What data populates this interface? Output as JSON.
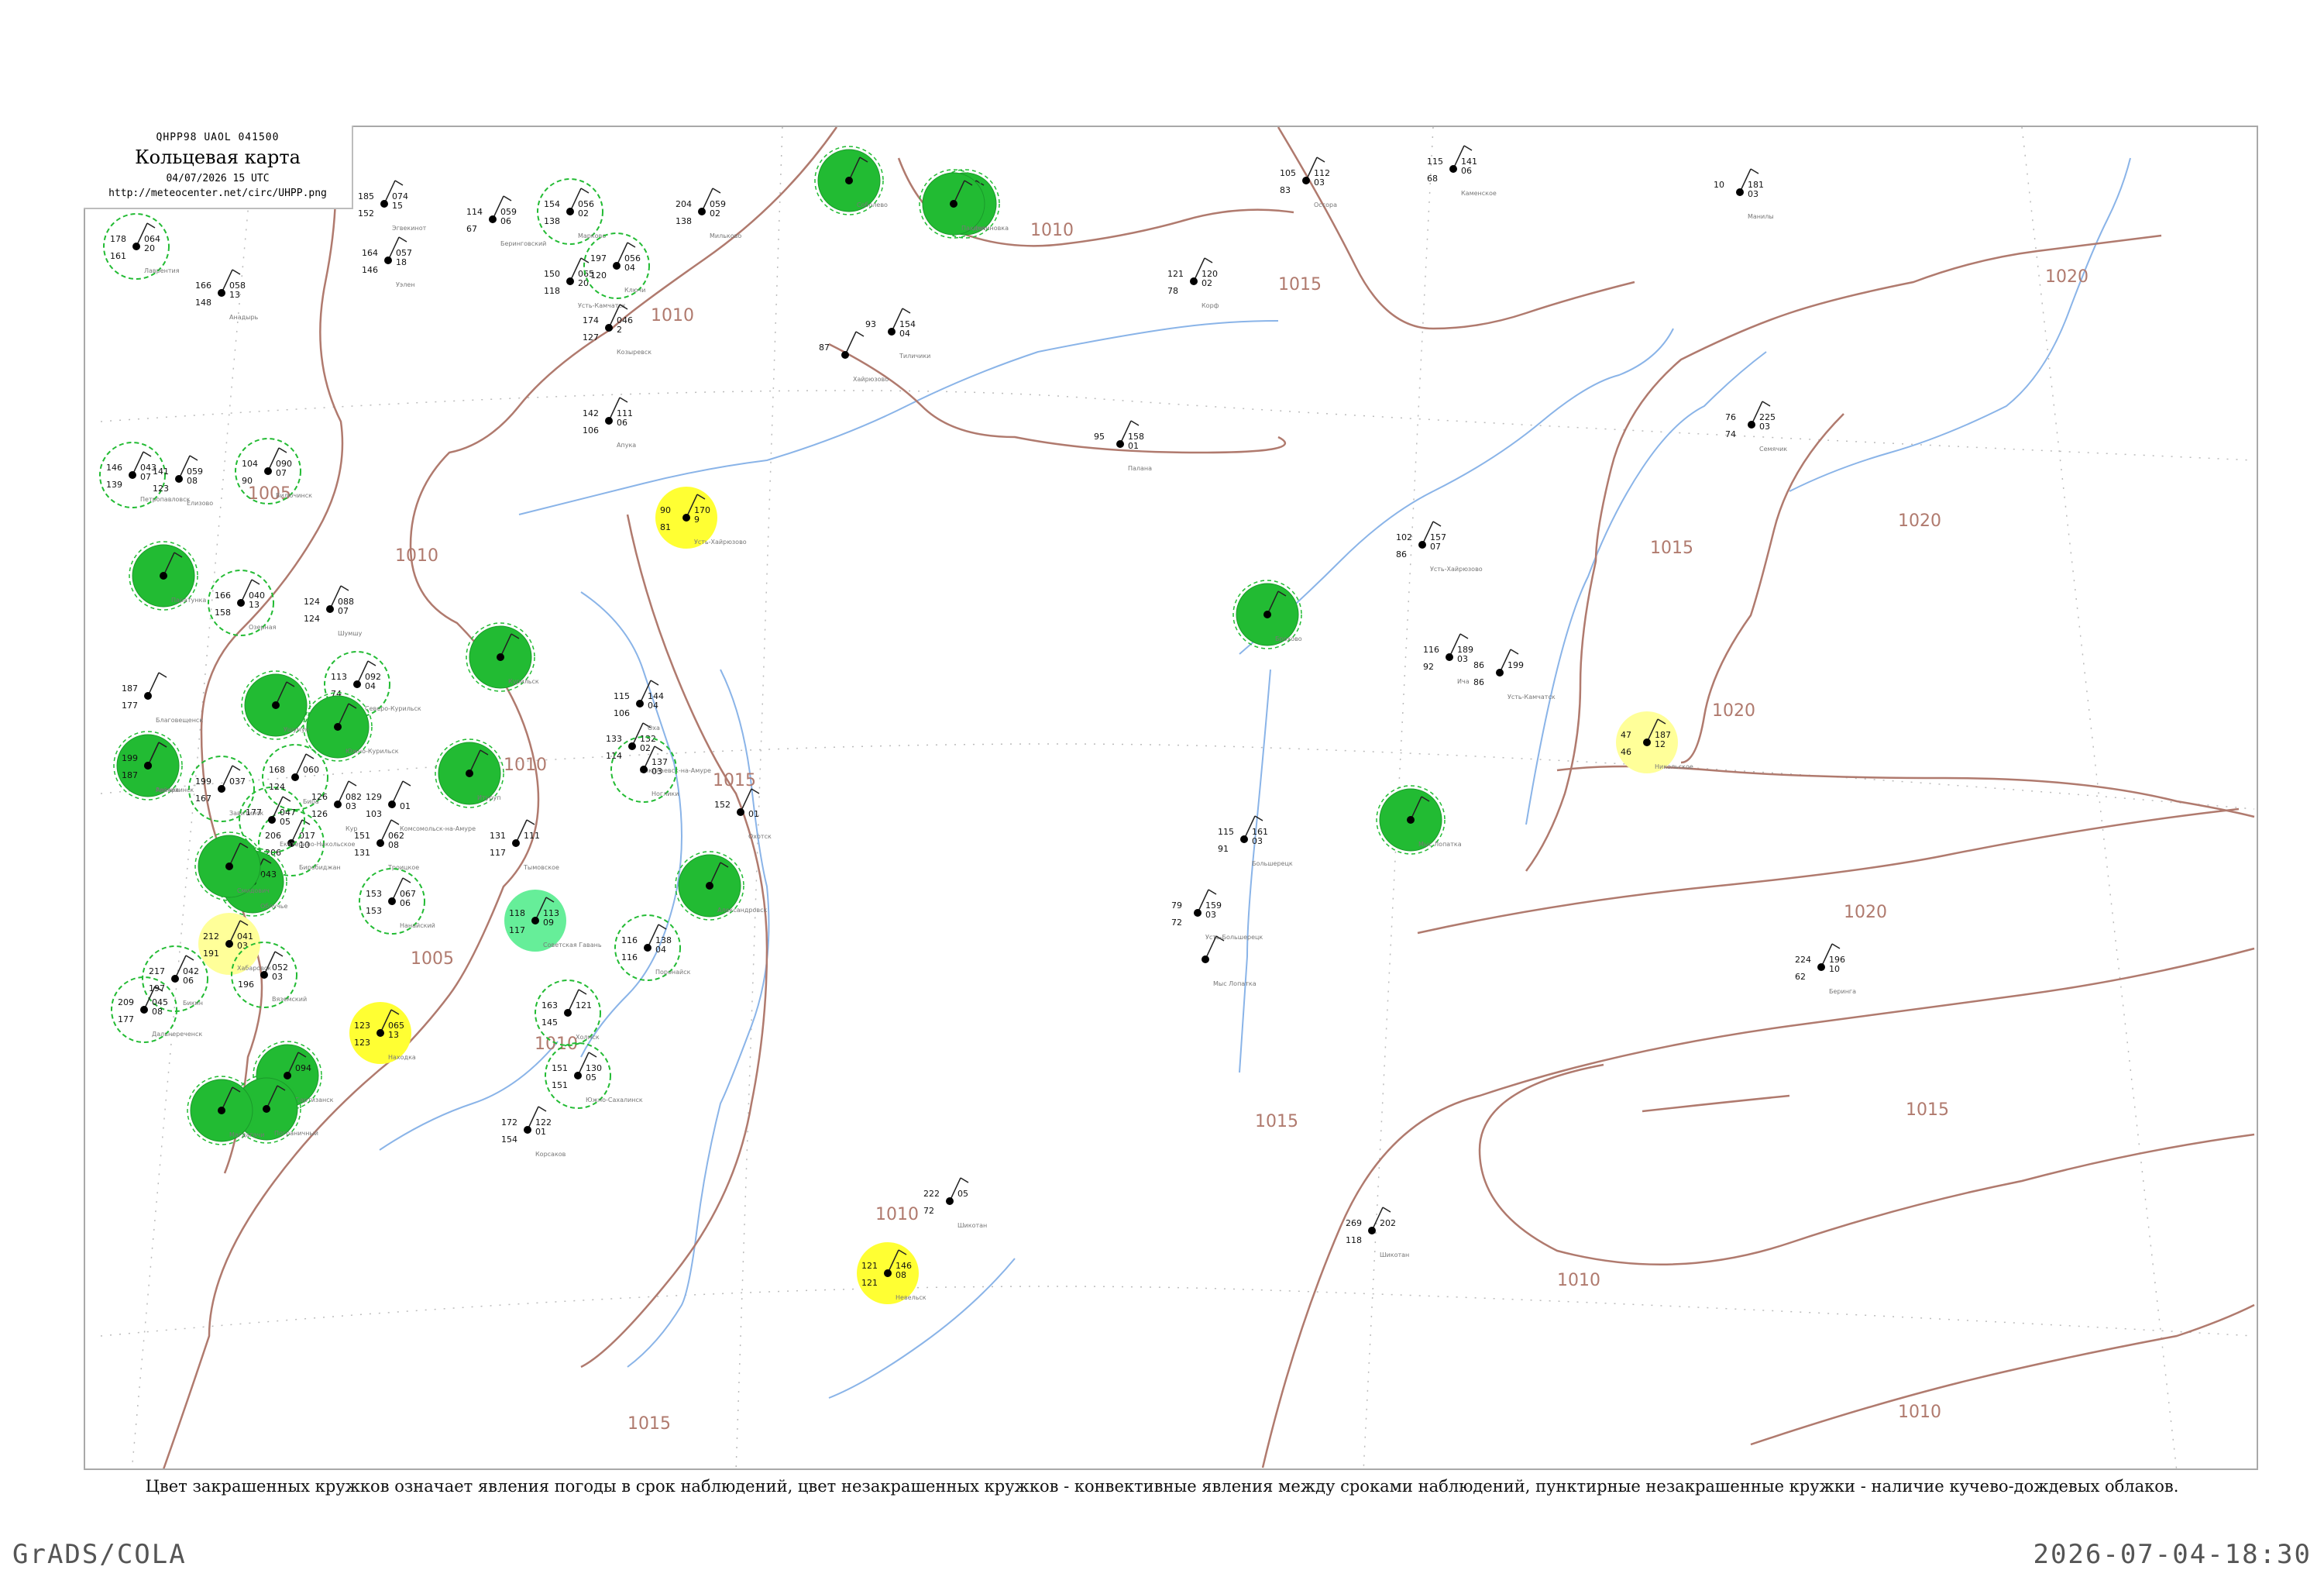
{
  "header": {
    "code": "QHPP98 UAOL 041500",
    "title": "Кольцевая карта",
    "date": "04/07/2026 15 UTC",
    "url": "http://meteocenter.net/circ/UHPP.png"
  },
  "caption": "Цвет закрашенных кружков означает явления погоды в срок наблюдений, цвет незакрашенных кружков - конвективные явления между сроками наблюдений, пунктирные незакрашенные кружки - наличие кучево-дождевых облаков.",
  "footer": {
    "left": "GrADS/COLA",
    "right": "2026-07-04-18:30"
  },
  "colors": {
    "isobar": "#b07a6e",
    "water": "#8ab4e8",
    "rain": "#22bb33",
    "drizzle": "#66ee99",
    "fog": "#ffff33",
    "haze": "#ffff99",
    "cb_ring": "#22bb33"
  },
  "isobar_labels": [
    {
      "text": "1005"
    },
    {
      "text": "1005"
    },
    {
      "text": "1010"
    },
    {
      "text": "1010"
    },
    {
      "text": "1010"
    },
    {
      "text": "1010"
    },
    {
      "text": "1015"
    },
    {
      "text": "1015"
    },
    {
      "text": "1015"
    },
    {
      "text": "1015"
    },
    {
      "text": "1020"
    },
    {
      "text": "1020"
    },
    {
      "text": "1020"
    },
    {
      "text": "1020"
    },
    {
      "text": "1015"
    },
    {
      "text": "1010"
    },
    {
      "text": "1010"
    },
    {
      "text": "1010"
    },
    {
      "text": "1015"
    },
    {
      "text": "1010"
    }
  ],
  "stations": [
    {
      "t": "178",
      "dp": "161",
      "p": "064",
      "pt": "20",
      "name": "Лаврентия",
      "circle": "cb"
    },
    {
      "t": "185",
      "dp": "152",
      "p": "074",
      "pt": "15",
      "name": "Эгвекинот",
      "circle": "none"
    },
    {
      "t": "164",
      "dp": "146",
      "p": "057",
      "pt": "18",
      "name": "Уэлен",
      "circle": "none"
    },
    {
      "t": "166",
      "dp": "148",
      "p": "058",
      "pt": "13",
      "name": "Анадырь",
      "circle": "none"
    },
    {
      "t": "114",
      "dp": "67",
      "p": "059",
      "pt": "06",
      "name": "Беринговский",
      "circle": "none"
    },
    {
      "t": "154",
      "dp": "138",
      "p": "056",
      "pt": "02",
      "name": "Марково",
      "circle": "cb"
    },
    {
      "t": "150",
      "dp": "118",
      "p": "065",
      "pt": "20",
      "name": "Усть-Камчатск",
      "circle": "none"
    },
    {
      "t": "197",
      "dp": "120",
      "p": "056",
      "pt": "04",
      "name": "Ключи",
      "circle": "cb"
    },
    {
      "t": "174",
      "dp": "127",
      "p": "046",
      "pt": "2",
      "name": "Козыревск",
      "circle": "none"
    },
    {
      "t": "204",
      "dp": "138",
      "p": "059",
      "pt": "02",
      "name": "Мильково",
      "circle": "none"
    },
    {
      "t": "",
      "dp": "",
      "p": "",
      "pt": "",
      "name": "Соболево",
      "circle": "rain"
    },
    {
      "t": "",
      "dp": "",
      "p": "",
      "pt": "",
      "name": "Долиновка",
      "circle": "rain"
    },
    {
      "t": "105",
      "dp": "83",
      "p": "112",
      "pt": "03",
      "name": "Оссора",
      "circle": "none"
    },
    {
      "t": "115",
      "dp": "68",
      "p": "141",
      "pt": "06",
      "name": "Каменское",
      "circle": "none"
    },
    {
      "t": "10",
      "dp": "",
      "p": "181",
      "pt": "03",
      "name": "Манилы",
      "circle": "none"
    },
    {
      "t": "121",
      "dp": "78",
      "p": "120",
      "pt": "02",
      "name": "Корф",
      "circle": "none"
    },
    {
      "t": "93",
      "dp": "",
      "p": "154",
      "pt": "04",
      "name": "Тиличики",
      "circle": "none"
    },
    {
      "t": "87",
      "dp": "",
      "p": "",
      "pt": "",
      "name": "Хайрюзово",
      "circle": "none"
    },
    {
      "t": "",
      "dp": "",
      "p": "",
      "pt": "",
      "name": "Пахачи",
      "circle": "rain"
    },
    {
      "t": "142",
      "dp": "106",
      "p": "111",
      "pt": "06",
      "name": "Апука",
      "circle": "none"
    },
    {
      "t": "146",
      "dp": "139",
      "p": "043",
      "pt": "07",
      "name": "Петропавловск",
      "circle": "cb"
    },
    {
      "t": "141",
      "dp": "123",
      "p": "059",
      "pt": "08",
      "name": "Елизово",
      "circle": "none"
    },
    {
      "t": "104",
      "dp": "90",
      "p": "090",
      "pt": "07",
      "name": "Вилючинск",
      "circle": "cb"
    },
    {
      "t": "",
      "dp": "",
      "p": "",
      "pt": "",
      "name": "Паратунка",
      "circle": "rain"
    },
    {
      "t": "166",
      "dp": "158",
      "p": "040",
      "pt": "13",
      "name": "Озерная",
      "circle": "cb"
    },
    {
      "t": "90",
      "dp": "81",
      "p": "170",
      "pt": "9",
      "name": "Усть-Хайрюзово",
      "circle": "fog"
    },
    {
      "t": "95",
      "dp": "",
      "p": "158",
      "pt": "01",
      "name": "Палана",
      "circle": "none"
    },
    {
      "t": "124",
      "dp": "124",
      "p": "088",
      "pt": "07",
      "name": "Шумшу",
      "circle": "none"
    },
    {
      "t": "113",
      "dp": "74",
      "p": "092",
      "pt": "04",
      "name": "Северо-Курильск",
      "circle": "cb"
    },
    {
      "t": "",
      "dp": "",
      "p": "",
      "pt": "",
      "name": "Курильск",
      "circle": "rain"
    },
    {
      "t": "",
      "dp": "",
      "p": "",
      "pt": "",
      "name": "Южно-Курильск",
      "circle": "rain"
    },
    {
      "t": "",
      "dp": "",
      "p": "",
      "pt": "",
      "name": "Итуруп",
      "circle": "rain"
    },
    {
      "t": "129",
      "dp": "103",
      "p": "",
      "pt": "01",
      "name": "Комсомольск-на-Амуре",
      "circle": "none"
    },
    {
      "t": "133",
      "dp": "114",
      "p": "132",
      "pt": "02",
      "name": "Николаевск-на-Амуре",
      "circle": "none"
    },
    {
      "t": "115",
      "dp": "106",
      "p": "144",
      "pt": "04",
      "name": "Оха",
      "circle": "none"
    },
    {
      "t": "",
      "dp": "",
      "p": "137",
      "pt": "03",
      "name": "Ноглики",
      "circle": "cb"
    },
    {
      "t": "152",
      "dp": "",
      "p": "",
      "pt": "01",
      "name": "Охотск",
      "circle": "none"
    },
    {
      "t": "",
      "dp": "",
      "p": "",
      "pt": "",
      "name": "Александровск",
      "circle": "rain"
    },
    {
      "t": "131",
      "dp": "117",
      "p": "111",
      "pt": "",
      "name": "Тымовское",
      "circle": "none"
    },
    {
      "t": "118",
      "dp": "117",
      "p": "113",
      "pt": "09",
      "name": "Советская Гавань",
      "circle": "drizzle"
    },
    {
      "t": "116",
      "dp": "116",
      "p": "138",
      "pt": "04",
      "name": "Поронайск",
      "circle": "cb"
    },
    {
      "t": "163",
      "dp": "145",
      "p": "121",
      "pt": "",
      "name": "Холмск",
      "circle": "cb"
    },
    {
      "t": "151",
      "dp": "151",
      "p": "130",
      "pt": "05",
      "name": "Южно-Сахалинск",
      "circle": "cb"
    },
    {
      "t": "123",
      "dp": "123",
      "p": "065",
      "pt": "13",
      "name": "Находка",
      "circle": "fog"
    },
    {
      "t": "212",
      "dp": "191",
      "p": "041",
      "pt": "03",
      "name": "Хабаровск",
      "circle": "haze"
    },
    {
      "t": "217",
      "dp": "197",
      "p": "042",
      "pt": "06",
      "name": "Бикин",
      "circle": "cb"
    },
    {
      "t": "209",
      "dp": "177",
      "p": "045",
      "pt": "08",
      "name": "Дальнереченск",
      "circle": "cb"
    },
    {
      "t": "",
      "dp": "196",
      "p": "052",
      "pt": "03",
      "name": "Вяземский",
      "circle": "cb"
    },
    {
      "t": "",
      "dp": "",
      "p": "094",
      "pt": "",
      "name": "Партизанск",
      "circle": "rain"
    },
    {
      "t": "",
      "dp": "",
      "p": "",
      "pt": "",
      "name": "Пограничный",
      "circle": "rain"
    },
    {
      "t": "206",
      "dp": "206",
      "p": "017",
      "pt": "10",
      "name": "Биробиджан",
      "circle": "cb"
    },
    {
      "t": "",
      "dp": "",
      "p": "043",
      "pt": "",
      "name": "Облучье",
      "circle": "rain"
    },
    {
      "t": "",
      "dp": "",
      "p": "",
      "pt": "",
      "name": "Смидович",
      "circle": "rain"
    },
    {
      "t": "",
      "dp": "",
      "p": "",
      "pt": "",
      "name": "Архара",
      "circle": "rain"
    },
    {
      "t": "177",
      "dp": "",
      "p": "047",
      "pt": "05",
      "name": "Екатерино-Никольское",
      "circle": "cb"
    },
    {
      "t": "168",
      "dp": "124",
      "p": "060",
      "pt": "",
      "name": "Бира",
      "circle": "cb"
    },
    {
      "t": "199",
      "dp": "167",
      "p": "037",
      "pt": "",
      "name": "Завитинск",
      "circle": "cb"
    },
    {
      "t": "187",
      "dp": "177",
      "p": "",
      "pt": "",
      "name": "Благовещенск",
      "circle": "none"
    },
    {
      "t": "199",
      "dp": "187",
      "p": "",
      "pt": "",
      "name": "Райчихинск",
      "circle": "none"
    },
    {
      "t": "126",
      "dp": "126",
      "p": "082",
      "pt": "03",
      "name": "Кур",
      "circle": "none"
    },
    {
      "t": "151",
      "dp": "131",
      "p": "062",
      "pt": "08",
      "name": "Троицкое",
      "circle": "none"
    },
    {
      "t": "153",
      "dp": "153",
      "p": "067",
      "pt": "06",
      "name": "Нанайский",
      "circle": "cb"
    },
    {
      "t": "",
      "dp": "",
      "p": "",
      "pt": "",
      "name": "Ушумун",
      "circle": "rain"
    },
    {
      "t": "",
      "dp": "",
      "p": "",
      "pt": "",
      "name": "Магдагачи",
      "circle": "rain"
    },
    {
      "t": "102",
      "dp": "86",
      "p": "157",
      "pt": "07",
      "name": "Усть-Хайрюзово",
      "circle": "none"
    },
    {
      "t": "",
      "dp": "",
      "p": "",
      "pt": "",
      "name": "Брохово",
      "circle": "rain"
    },
    {
      "t": "116",
      "dp": "92",
      "p": "189",
      "pt": "03",
      "name": "Ича",
      "circle": "none"
    },
    {
      "t": "86",
      "dp": "86",
      "p": "199",
      "pt": "",
      "name": "Усть-Камчатск",
      "circle": "none"
    },
    {
      "t": "47",
      "dp": "46",
      "p": "187",
      "pt": "12",
      "name": "Никольское",
      "circle": "haze"
    },
    {
      "t": "76",
      "dp": "74",
      "p": "225",
      "pt": "03",
      "name": "Семячик",
      "circle": "none"
    },
    {
      "t": "",
      "dp": "",
      "p": "",
      "pt": "",
      "name": "Мыс Лопатка",
      "circle": "rain"
    },
    {
      "t": "115",
      "dp": "91",
      "p": "161",
      "pt": "03",
      "name": "Большерецк",
      "circle": "none"
    },
    {
      "t": "79",
      "dp": "72",
      "p": "159",
      "pt": "03",
      "name": "Усть-Большерецк",
      "circle": "none"
    },
    {
      "t": "",
      "dp": "",
      "p": "",
      "pt": "",
      "name": "Мыс Лопатка",
      "circle": "none"
    },
    {
      "t": "224",
      "dp": "62",
      "p": "196",
      "pt": "10",
      "name": "Беринга",
      "circle": "none"
    },
    {
      "t": "222",
      "dp": "72",
      "p": "05",
      "pt": "",
      "name": "Шикотан",
      "circle": "none"
    },
    {
      "t": "121",
      "dp": "121",
      "p": "146",
      "pt": "08",
      "name": "Невельск",
      "circle": "fog"
    },
    {
      "t": "269",
      "dp": "118",
      "p": "202",
      "pt": "",
      "name": "Шикотан",
      "circle": "none"
    },
    {
      "t": "172",
      "dp": "154",
      "p": "122",
      "pt": "01",
      "name": "Корсаков",
      "circle": "none"
    }
  ]
}
